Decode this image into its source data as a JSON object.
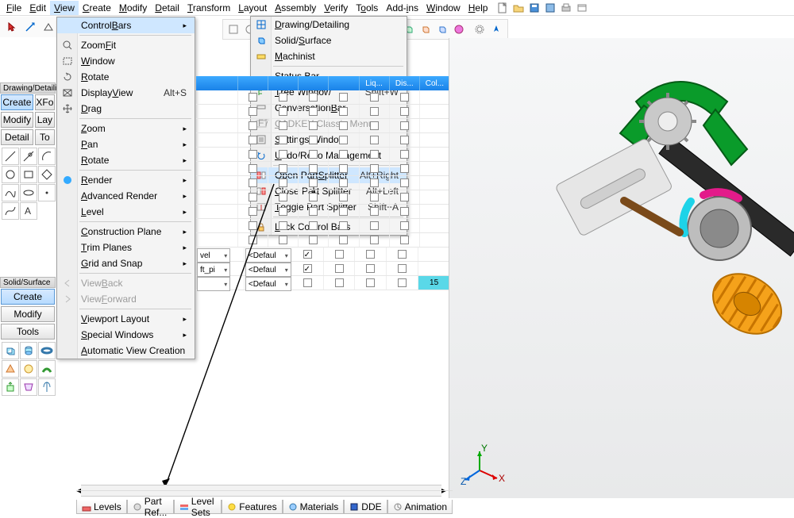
{
  "menubar": {
    "items": [
      {
        "label": "File",
        "ul": "F"
      },
      {
        "label": "Edit",
        "ul": "E"
      },
      {
        "label": "View",
        "ul": "V",
        "open": true
      },
      {
        "label": "Create",
        "ul": "C"
      },
      {
        "label": "Modify",
        "ul": "M"
      },
      {
        "label": "Detail",
        "ul": "D"
      },
      {
        "label": "Transform",
        "ul": "T"
      },
      {
        "label": "Layout",
        "ul": "L"
      },
      {
        "label": "Assembly",
        "ul": "A"
      },
      {
        "label": "Verify",
        "ul": "V"
      },
      {
        "label": "Tools",
        "ul": "T"
      },
      {
        "label": "Add-ins",
        "ul": "A"
      },
      {
        "label": "Window",
        "ul": "W"
      },
      {
        "label": "Help",
        "ul": "H"
      }
    ]
  },
  "view_menu": {
    "items": [
      {
        "label": "Control Bars",
        "ul": "B",
        "sub": true,
        "highlight": true
      },
      {
        "label": "Zoom Fit",
        "ul": "F",
        "icon": "zoom-fit"
      },
      {
        "label": "Window",
        "ul": "W",
        "icon": "window-zoom"
      },
      {
        "label": "Rotate",
        "ul": "R",
        "icon": "rotate-view"
      },
      {
        "label": "Display View",
        "ul": "V",
        "shortcut": "Alt+S",
        "icon": "display-view"
      },
      {
        "label": "Drag",
        "ul": "D",
        "icon": "drag"
      },
      {
        "sep": true
      },
      {
        "label": "Zoom",
        "ul": "Z",
        "sub": true
      },
      {
        "label": "Pan",
        "ul": "P",
        "sub": true
      },
      {
        "label": "Rotate",
        "ul": "R",
        "sub": true
      },
      {
        "sep": true
      },
      {
        "label": "Render",
        "ul": "R",
        "sub": true,
        "icon": "render"
      },
      {
        "label": "Advanced Render",
        "ul": "A",
        "sub": true
      },
      {
        "label": "Level",
        "ul": "L",
        "sub": true
      },
      {
        "sep": true
      },
      {
        "label": "Construction Plane",
        "ul": "C",
        "sub": true
      },
      {
        "label": "Trim Planes",
        "ul": "T",
        "sub": true
      },
      {
        "label": "Grid and Snap",
        "ul": "G",
        "sub": true
      },
      {
        "sep": true
      },
      {
        "label": "View Back",
        "ul": "B",
        "disabled": true,
        "icon": "back"
      },
      {
        "label": "View Forward",
        "ul": "F",
        "disabled": true,
        "icon": "forward"
      },
      {
        "sep": true
      },
      {
        "label": "Viewport Layout",
        "ul": "V",
        "sub": true
      },
      {
        "label": "Special Windows",
        "ul": "S",
        "sub": true
      },
      {
        "label": "Automatic View Creation",
        "ul": "A"
      }
    ]
  },
  "control_bars_submenu": {
    "items": [
      {
        "label": "Drawing/Detailing",
        "ul": "D",
        "icon": "drawing"
      },
      {
        "label": "Solid/Surface",
        "ul": "S",
        "icon": "solid"
      },
      {
        "label": "Machinist",
        "ul": "M",
        "icon": "machinist"
      },
      {
        "sep": true
      },
      {
        "label": "Status Bar",
        "ul": "S",
        "icon": "status"
      },
      {
        "label": "Tree Window",
        "ul": "T",
        "shortcut": "Shift+W",
        "icon": "tree"
      },
      {
        "label": "Conversation Bar",
        "ul": "B",
        "icon": "convo"
      },
      {
        "label": "CADKEY Classic Menu",
        "ul": "C",
        "disabled": true,
        "icon": "f7"
      },
      {
        "label": "Settings Window",
        "ul": "S",
        "icon": "settings"
      },
      {
        "label": "Undo/Redo Management",
        "ul": "U",
        "icon": "undo"
      },
      {
        "sep": true
      },
      {
        "label": "Open Part Splitter",
        "ul": "S",
        "shortcut": "Alt+Right",
        "icon": "open-split",
        "highlight": true
      },
      {
        "label": "Close Part Splitter",
        "ul": "C",
        "shortcut": "Alt+Left",
        "icon": "close-split"
      },
      {
        "label": "Toggle Part Splitter",
        "ul": "T",
        "shortcut": "Shift+A",
        "icon": "toggle-split"
      },
      {
        "sep": true
      },
      {
        "label": "Lock Control Bars",
        "ul": "L",
        "icon": "lock"
      }
    ]
  },
  "left_panels": {
    "drawing": {
      "title": "Drawing/Detailing",
      "buttons": [
        "Create",
        "XFo",
        "Modify",
        "Lay",
        "Detail",
        "To"
      ],
      "selected": 0
    },
    "solid": {
      "title": "Solid/Surface",
      "buttons": [
        "Create",
        "Modify",
        "Tools"
      ],
      "selected": 0
    }
  },
  "table": {
    "visible_headers": [
      "Liq...",
      "Dis...",
      "Col..."
    ],
    "count_badge": "15",
    "dropdown_rows": [
      {
        "a": "vel",
        "b": "<Defaul",
        "chk": true
      },
      {
        "a": "ft_pi",
        "b": "<Defaul",
        "chk": true
      },
      {
        "a": "",
        "b": "<Defaul",
        "chk": false
      }
    ]
  },
  "bottom_tabs": [
    {
      "label": "Levels",
      "icon": "levels"
    },
    {
      "label": "Part Ref...",
      "icon": "partref"
    },
    {
      "label": "Level Sets",
      "icon": "levelsets"
    },
    {
      "label": "Features",
      "icon": "features"
    },
    {
      "label": "Materials",
      "icon": "materials"
    },
    {
      "label": "DDE",
      "icon": "dde"
    },
    {
      "label": "Animation",
      "icon": "anim"
    }
  ],
  "axis_labels": {
    "x": "X",
    "y": "Y",
    "z": "Z"
  }
}
